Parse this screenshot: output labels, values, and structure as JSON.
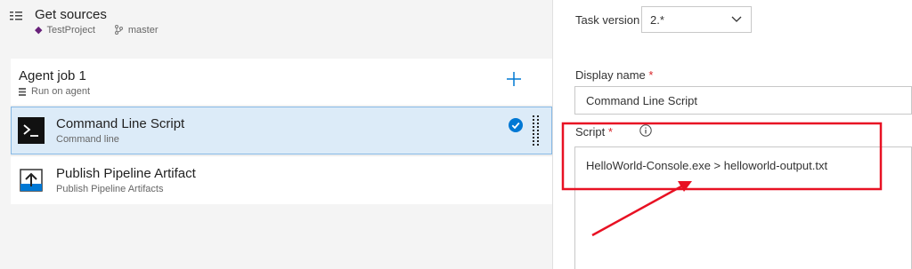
{
  "get_sources": {
    "title": "Get sources",
    "project": "TestProject",
    "branch": "master"
  },
  "agent_job": {
    "title": "Agent job 1",
    "subtitle": "Run on agent"
  },
  "tasks": [
    {
      "title": "Command Line Script",
      "subtitle": "Command line"
    },
    {
      "title": "Publish Pipeline Artifact",
      "subtitle": "Publish Pipeline Artifacts"
    }
  ],
  "settings": {
    "task_version_label": "Task version",
    "task_version_value": "2.*",
    "display_name_label": "Display name",
    "display_name_value": "Command Line Script",
    "script_label": "Script",
    "script_value": "HelloWorld-Console.exe > helloworld-output.txt",
    "required_marker": "*"
  },
  "colors": {
    "accent": "#0078d4",
    "selected_bg": "#dcebf8",
    "annotation_red": "#e81123",
    "required_red": "#d9262a"
  },
  "icons": [
    "list-icon",
    "visual-studio-icon",
    "branch-icon",
    "server-icon",
    "plus-icon",
    "terminal-icon",
    "check-circle-icon",
    "drag-handle-icon",
    "publish-artifact-icon",
    "chevron-down-icon",
    "info-icon"
  ]
}
